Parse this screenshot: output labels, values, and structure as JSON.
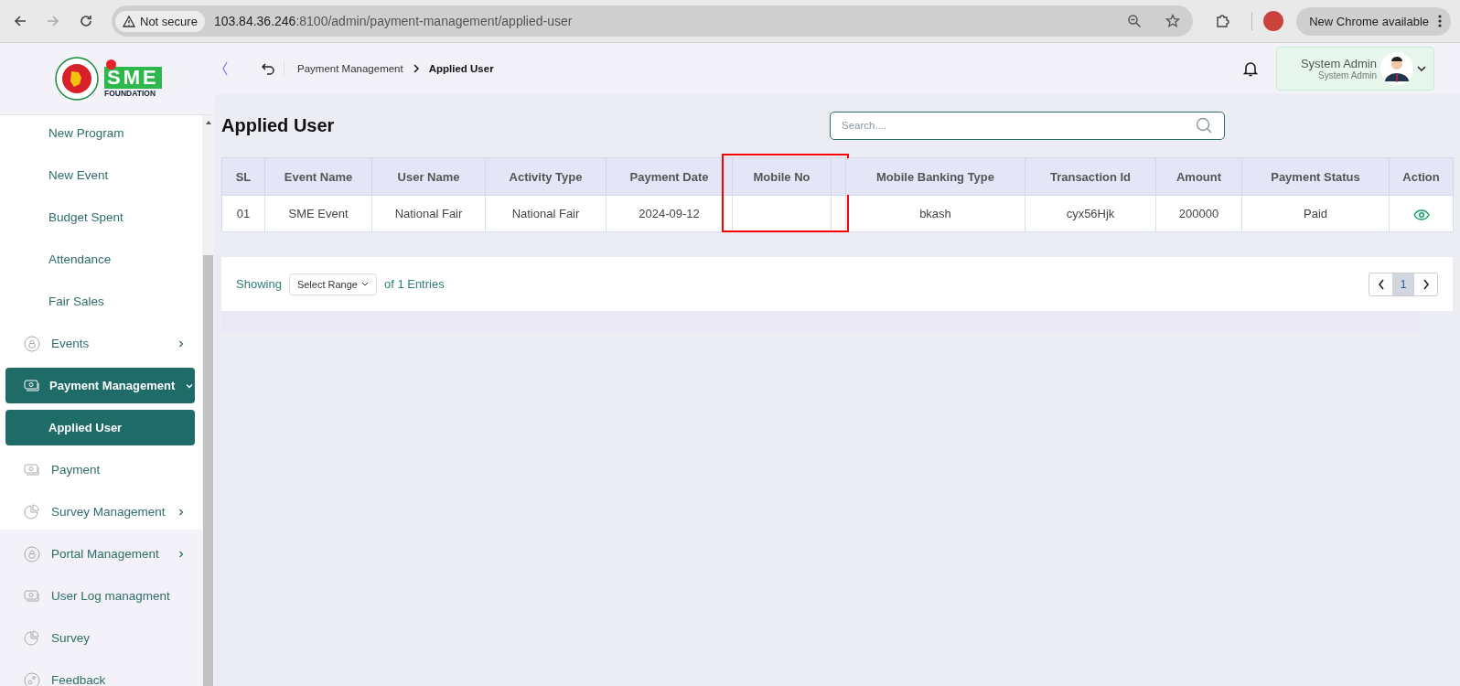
{
  "browser": {
    "security": "Not secure",
    "url_host": "103.84.36.246",
    "url_path": ":8100/admin/payment-management/applied-user",
    "update_label": "New Chrome available"
  },
  "logo": {
    "mark": "SME",
    "subtitle": "FOUNDATION"
  },
  "breadcrumb": [
    {
      "label": "Payment Management",
      "current": false
    },
    {
      "label": "Applied User",
      "current": true
    }
  ],
  "user": {
    "name": "System Admin",
    "role": "System Admin"
  },
  "sidebar": {
    "group": [
      {
        "label": "New Program",
        "kind": "sub",
        "selected": false
      },
      {
        "label": "New Event",
        "kind": "sub",
        "selected": false
      },
      {
        "label": "Budget Spent",
        "kind": "sub",
        "selected": false
      },
      {
        "label": "Attendance",
        "kind": "sub",
        "selected": false
      },
      {
        "label": "Fair Sales",
        "kind": "sub",
        "selected": false
      },
      {
        "label": "Events",
        "kind": "lock",
        "selected": false,
        "expanded": false
      },
      {
        "label": "Payment Management",
        "kind": "cash",
        "selected": true,
        "expanded": true
      },
      {
        "label": "Applied User",
        "kind": "sub",
        "selected": true
      },
      {
        "label": "Payment",
        "kind": "cash",
        "selected": false
      },
      {
        "label": "Survey Management",
        "kind": "chart",
        "selected": false,
        "expanded": false
      }
    ],
    "items": [
      {
        "label": "Portal Management",
        "kind": "lock",
        "selected": false,
        "expanded": false
      },
      {
        "label": "User Log managment",
        "kind": "cash",
        "selected": false
      },
      {
        "label": "Survey",
        "kind": "chart",
        "selected": false
      },
      {
        "label": "Feedback",
        "kind": "feedback",
        "selected": false
      }
    ]
  },
  "page_title": "Applied User",
  "search": {
    "placeholder": "Search...."
  },
  "table": {
    "columns": [
      {
        "label": "SL",
        "highlighted": false
      },
      {
        "label": "Event Name",
        "highlighted": false
      },
      {
        "label": "User Name",
        "highlighted": false
      },
      {
        "label": "Activity Type",
        "highlighted": false
      },
      {
        "label": "Payment Date",
        "highlighted": false
      },
      {
        "label": "Mobile No",
        "highlighted": true
      },
      {
        "highlighted": false
      },
      {
        "label": "Mobile Banking Type",
        "highlighted": false
      },
      {
        "label": "Transaction Id",
        "highlighted": false
      },
      {
        "label": "Amount",
        "highlighted": false
      },
      {
        "label": "Payment Status",
        "highlighted": false
      },
      {
        "label": "Action",
        "highlighted": false,
        "kind": "view"
      }
    ],
    "rows": [
      {
        "cells": [
          "01",
          "SME Event",
          "National Fair",
          "National Fair",
          "2024-09-12",
          null,
          null,
          "bkash",
          "cyx56Hjk",
          "200000",
          "Paid",
          null
        ]
      }
    ]
  },
  "pagination": {
    "showing": "Showing",
    "range": "Select Range",
    "entries": "of 1 Entries",
    "pages": [
      {
        "label": "1",
        "selected": true
      }
    ]
  }
}
